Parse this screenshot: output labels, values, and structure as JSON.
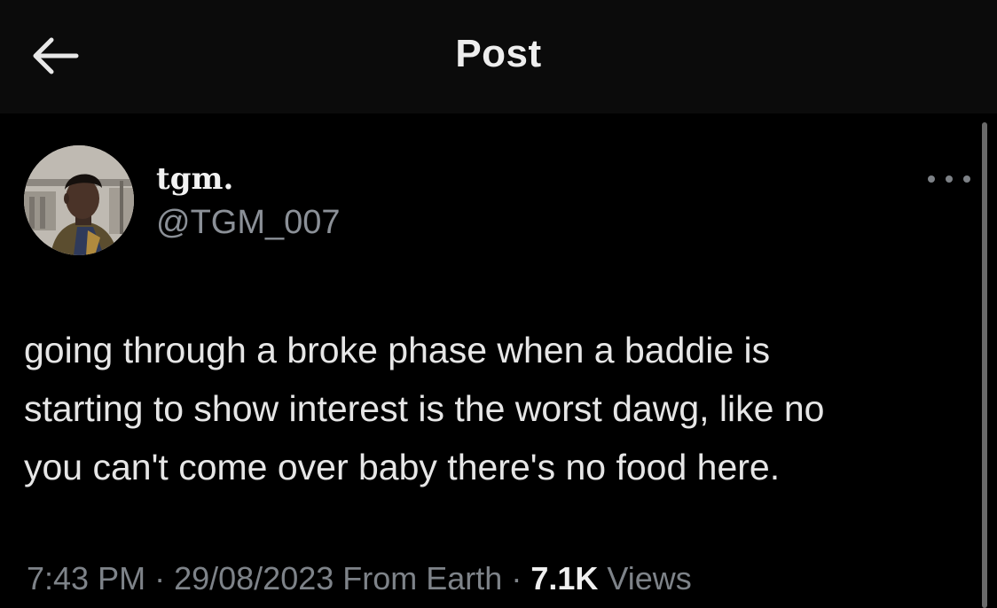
{
  "header": {
    "title": "Post",
    "back_icon": "arrow-left-icon"
  },
  "author": {
    "display_name": "tgm.",
    "handle": "@TGM_007",
    "avatar_icon": "profile-photo"
  },
  "more_icon": "more-horizontal-icon",
  "tweet": {
    "lines": [
      "going through a broke phase when a baddie is",
      "starting to show interest is the worst dawg, like no",
      "you can't come over baby there's no food here."
    ]
  },
  "meta": {
    "time": "7:43 PM",
    "separator": " · ",
    "date": "29/08/2023",
    "source": "From Earth",
    "views_count": "7.1K",
    "views_label": "Views"
  },
  "colors": {
    "background": "#000000",
    "header_background": "#0b0b0b",
    "text_primary": "#e7e9ea",
    "text_secondary": "#8b9097"
  }
}
